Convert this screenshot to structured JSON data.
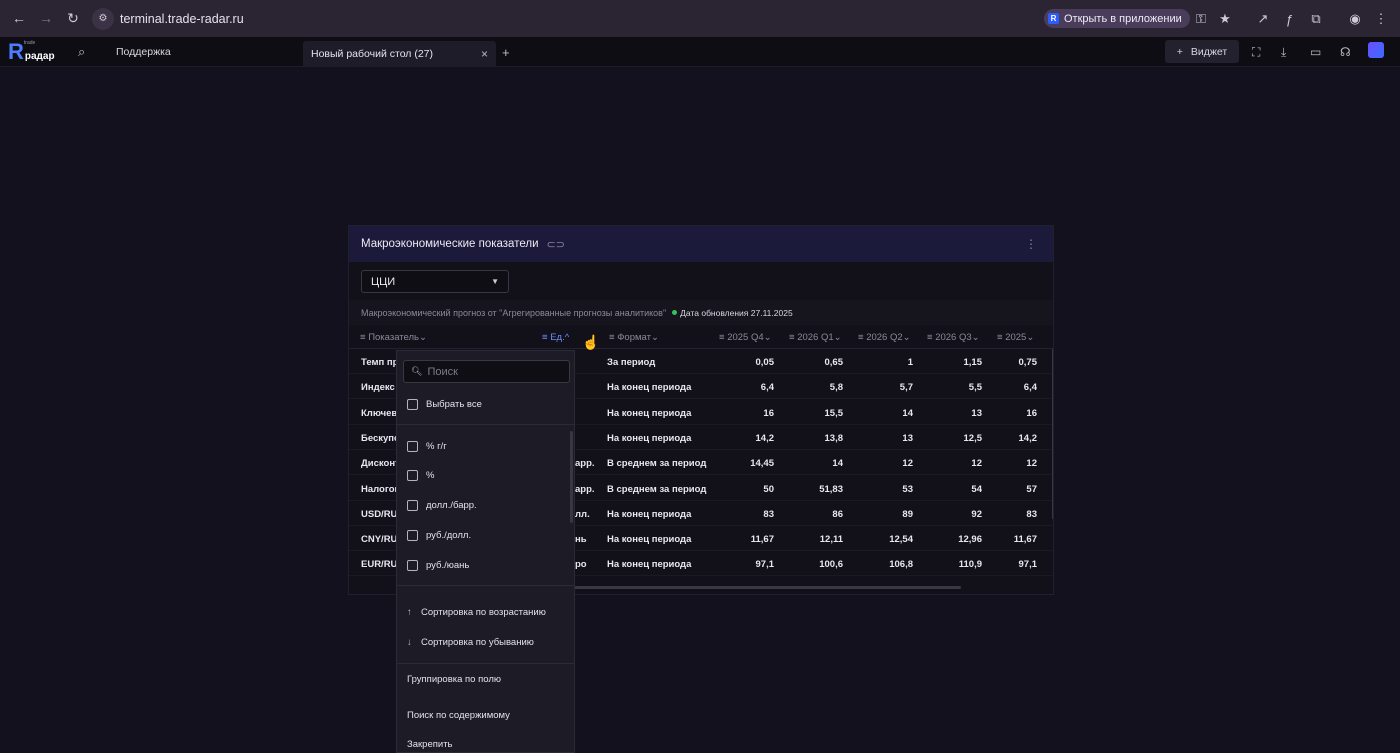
{
  "browser": {
    "url": "terminal.trade-radar.ru",
    "open_in_app": "Открыть в приложении"
  },
  "app": {
    "logo_big": "R",
    "logo_small": "радар",
    "logo_tiny": "trade",
    "support": "Поддержка",
    "tab_label": "Новый рабочий стол (27)",
    "widget_button": "Виджет"
  },
  "panel": {
    "title": "Макроэкономические показатели",
    "select_value": "ЦЦИ",
    "forecast_note": "Макроэкономический прогноз от \"Агрегированные прогнозы аналитиков\"",
    "update_date": "Дата обновления 27.11.2025",
    "columns": {
      "indicator": "Показатель",
      "unit": "Ед.",
      "format": "Формат",
      "c1": "2025 Q4",
      "c2": "2026 Q1",
      "c3": "2026 Q2",
      "c4": "2026 Q3",
      "c5": "2025"
    },
    "rows": [
      {
        "name": "Темп пр",
        "unit": "",
        "format": "За период",
        "v": [
          "0,05",
          "0,65",
          "1",
          "1,15",
          "0,75"
        ]
      },
      {
        "name": "Индекс",
        "unit": "",
        "format": "На конец периода",
        "v": [
          "6,4",
          "5,8",
          "5,7",
          "5,5",
          "6,4"
        ]
      },
      {
        "name": "Ключева",
        "unit": "",
        "format": "На конец периода",
        "v": [
          "16",
          "15,5",
          "14",
          "13",
          "16"
        ]
      },
      {
        "name": "Бескупо",
        "unit": "",
        "format": "На конец периода",
        "v": [
          "14,2",
          "13,8",
          "13",
          "12,5",
          "14,2"
        ]
      },
      {
        "name": "Дисконт",
        "unit": "арр.",
        "format": "В среднем за период",
        "v": [
          "14,45",
          "14",
          "12",
          "12",
          "12"
        ]
      },
      {
        "name": "Налогов",
        "unit": "арр.",
        "format": "В среднем за период",
        "v": [
          "50",
          "51,83",
          "53",
          "54",
          "57"
        ]
      },
      {
        "name": "USD/RU",
        "unit": "лл.",
        "format": "На конец периода",
        "v": [
          "83",
          "86",
          "89",
          "92",
          "83"
        ]
      },
      {
        "name": "CNY/RU",
        "unit": "нь",
        "format": "На конец периода",
        "v": [
          "11,67",
          "12,11",
          "12,54",
          "12,96",
          "11,67"
        ]
      },
      {
        "name": "EUR/RU",
        "unit": "ро",
        "format": "На конец периода",
        "v": [
          "97,1",
          "100,6",
          "106,8",
          "110,9",
          "97,1"
        ]
      }
    ]
  },
  "dropdown": {
    "search_placeholder": "Поиск",
    "select_all": "Выбрать все",
    "options": [
      "% г/г",
      "%",
      "долл./барр.",
      "руб./долл.",
      "руб./юань"
    ],
    "sort_asc": "Сортировка по возрастанию",
    "sort_desc": "Сортировка по убыванию",
    "group_by": "Группировка по полю",
    "search_content": "Поиск по содержимому",
    "pin": "Закрепить"
  },
  "colors": {
    "accent": "#6b8cff",
    "panel_header": "#1c1a3a",
    "status_dot": "#37c15b"
  }
}
